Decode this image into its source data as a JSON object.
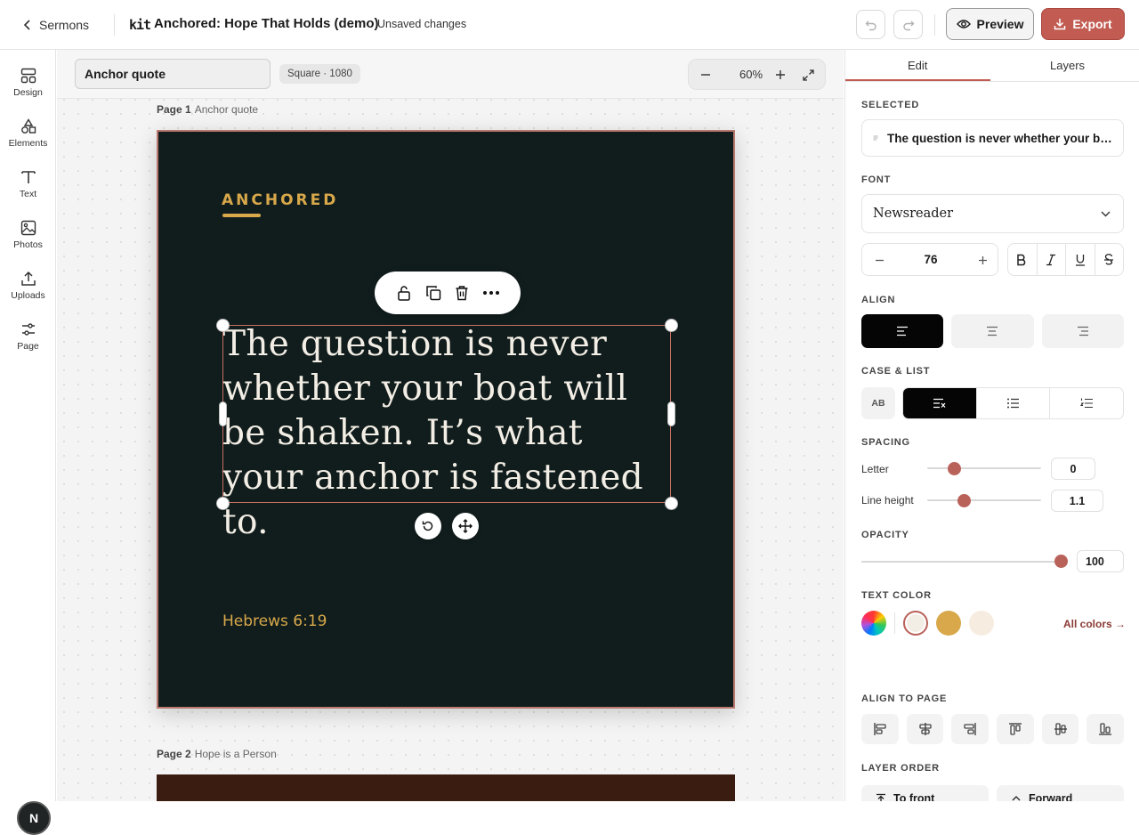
{
  "topbar": {
    "back_label": "Sermons",
    "logo": "kit",
    "title": "Anchored: Hope That Holds (demo)",
    "status": "Unsaved changes",
    "preview_label": "Preview",
    "export_label": "Export",
    "accent": "#c25b52"
  },
  "rail": {
    "items": [
      {
        "label": "Design",
        "icon": "layout-icon"
      },
      {
        "label": "Elements",
        "icon": "shapes-icon"
      },
      {
        "label": "Text",
        "icon": "text-icon"
      },
      {
        "label": "Photos",
        "icon": "image-icon"
      },
      {
        "label": "Uploads",
        "icon": "upload-icon"
      },
      {
        "label": "Page",
        "icon": "sliders-icon"
      }
    ],
    "avatar_initial": "N"
  },
  "canvas": {
    "page_name_value": "Anchor quote",
    "size_badge": "Square · 1080",
    "zoom": "60%",
    "page1": {
      "number": "Page 1",
      "name": "Anchor quote",
      "brand": "ANCHORED",
      "quote": "The question is never whether your boat will be shaken. It’s what your anchor is fastened to.",
      "reference": "Hebrews 6:19",
      "background": "#111d1d",
      "gold": "#d8a84a"
    },
    "page2": {
      "number": "Page 2",
      "name": "Hope is a Person",
      "background": "#3a1d10"
    }
  },
  "panel": {
    "tabs": [
      "Edit",
      "Layers"
    ],
    "active_tab": "Edit",
    "selected_label": "SELECTED",
    "selected_text": "The question is never whether your bo...",
    "font_label": "FONT",
    "font_value": "Newsreader",
    "font_size": "76",
    "style_buttons": [
      "B",
      "I",
      "U",
      "S"
    ],
    "align_label": "ALIGN",
    "align_active": "left",
    "case_label": "CASE & LIST",
    "case_button": "AB",
    "spacing_label": "SPACING",
    "letter_label": "Letter",
    "letter_value": "0",
    "line_height_label": "Line height",
    "line_height_value": "1.1",
    "opacity_label": "OPACITY",
    "opacity_value": "100",
    "text_color_label": "TEXT COLOR",
    "swatches": [
      "#f3eee5",
      "#d8a84a",
      "#f7ece0"
    ],
    "all_colors_label": "All colors →",
    "align_page_label": "ALIGN TO PAGE",
    "layer_order_label": "LAYER ORDER",
    "to_front_label": "To front",
    "forward_label": "Forward"
  }
}
